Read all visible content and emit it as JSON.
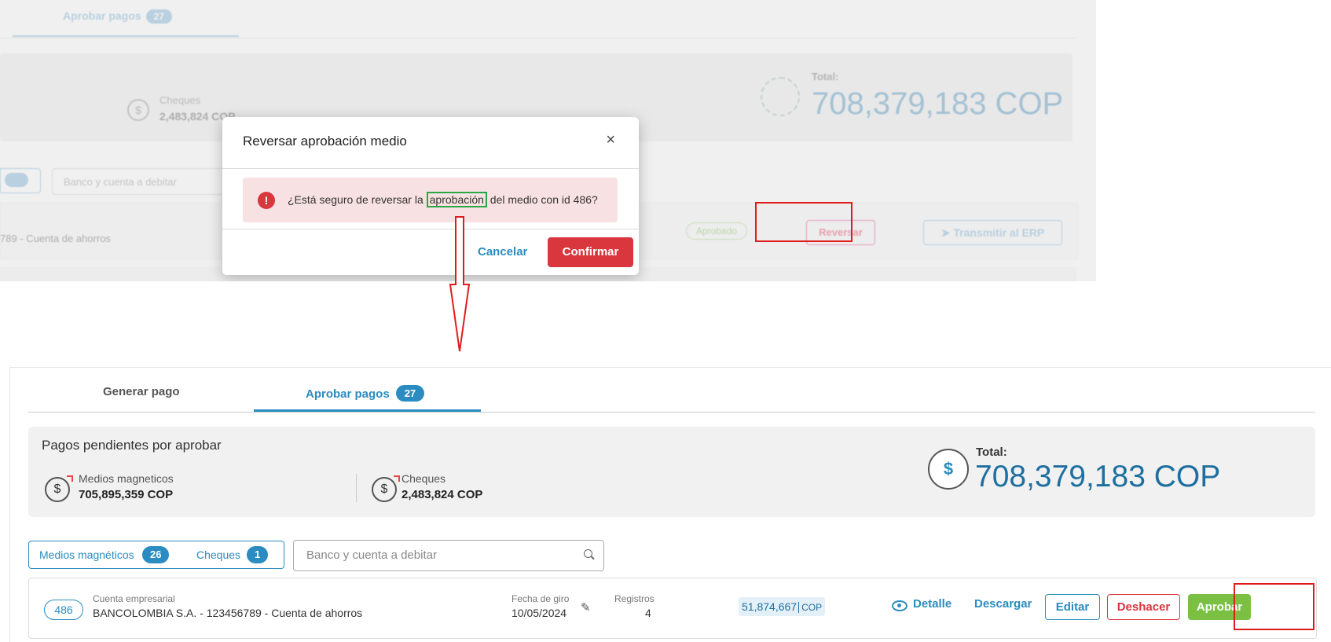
{
  "colors": {
    "accent": "#2a8cc0",
    "danger": "#d9363e",
    "success": "#7bc043",
    "highlight_red": "#e01b1b",
    "highlight_green": "#29a745"
  },
  "background": {
    "tab_label": "Aprobar pagos",
    "tab_count": "27",
    "cheques_label": "Cheques",
    "cheques_value": "2,483,824 COP",
    "total_label": "Total:",
    "total_value": "708,379,183 COP",
    "search_placeholder": "Banco y cuenta a debitar",
    "row_text": "789 - Cuenta de ahorros",
    "status_badge": "Aprobado",
    "reversar_button": "Reversar",
    "transmit_button": "Transmitir al ERP"
  },
  "modal": {
    "title": "Reversar aprobación medio",
    "close_icon": "close-icon",
    "message_before": "¿Está seguro de reversar la ",
    "message_highlight": "aprobación",
    "message_after": " del medio con id 486?",
    "cancel_label": "Cancelar",
    "confirm_label": "Confirmar"
  },
  "main": {
    "tabs": [
      {
        "label": "Generar pago"
      },
      {
        "label": "Aprobar pagos",
        "count": "27"
      }
    ],
    "summary": {
      "title": "Pagos pendientes por aprobar",
      "medios_label": "Medios magneticos",
      "medios_value": "705,895,359 COP",
      "cheques_label": "Cheques",
      "cheques_value": "2,483,824 COP",
      "total_label": "Total:",
      "total_value": "708,379,183 COP"
    },
    "filters": {
      "medios_label": "Medios magnéticos",
      "medios_count": "26",
      "cheques_label": "Cheques",
      "cheques_count": "1",
      "search_placeholder": "Banco y cuenta a debitar"
    },
    "row": {
      "id": "486",
      "account_type": "Cuenta empresarial",
      "account_name": "BANCOLOMBIA S.A. - 123456789 - Cuenta de ahorros",
      "fecha_label": "Fecha de giro",
      "fecha_value": "10/05/2024",
      "registros_label": "Registros",
      "registros_value": "4",
      "amount": "51,874,667",
      "currency": "COP",
      "detalle_label": "Detalle",
      "descargar_label": "Descargar",
      "editar_label": "Editar",
      "deshacer_label": "Deshacer",
      "aprobar_label": "Aprobar"
    }
  }
}
